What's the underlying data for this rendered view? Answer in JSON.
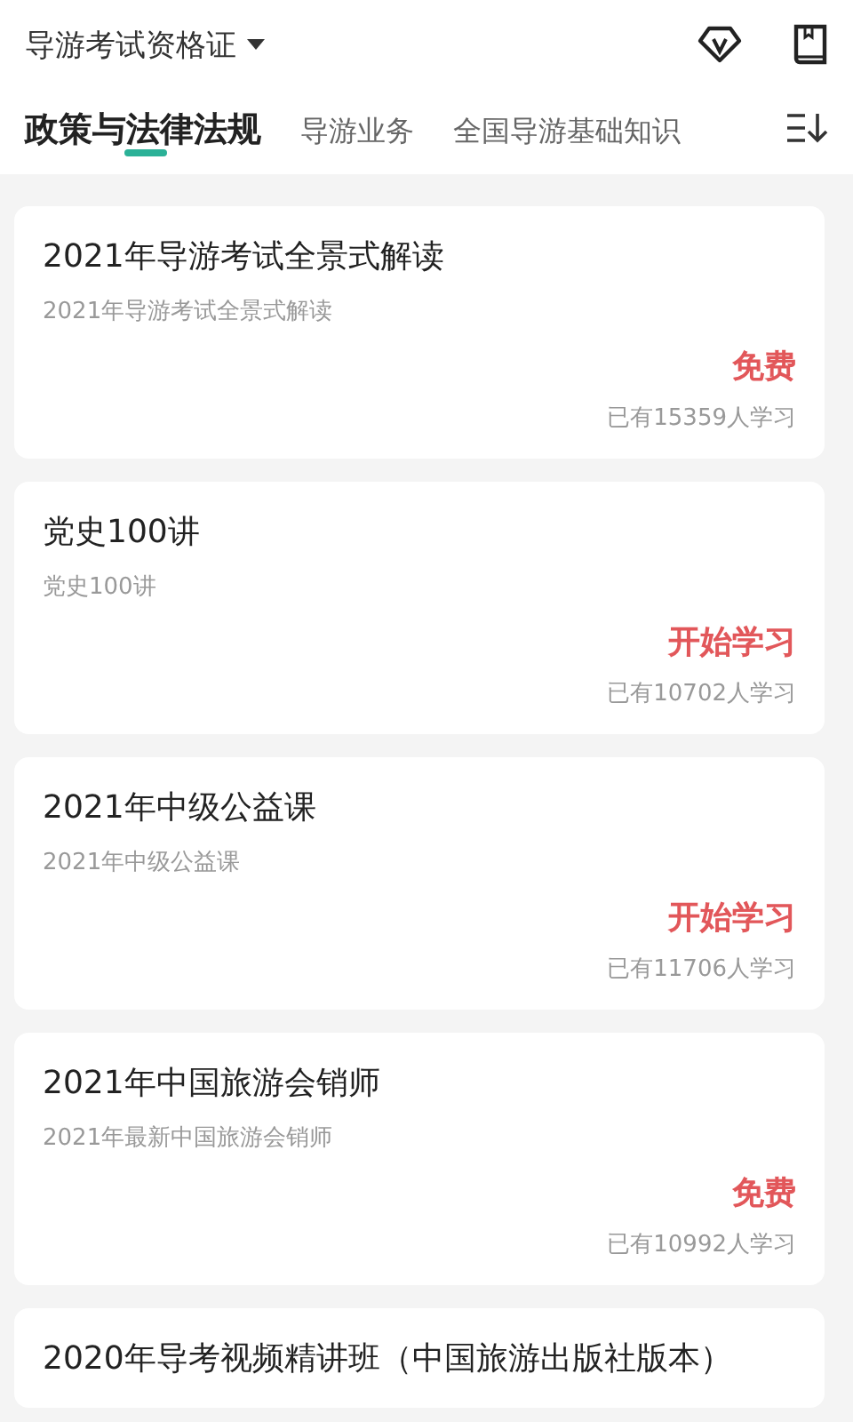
{
  "header": {
    "title": "导游考试资格证"
  },
  "tabs": [
    {
      "label": "政策与法律法规",
      "selected": true
    },
    {
      "label": "导游业务",
      "selected": false
    },
    {
      "label": "全国导游基础知识",
      "selected": false
    }
  ],
  "courses": [
    {
      "title": "2021年导游考试全景式解读",
      "subtitle": "2021年导游考试全景式解读",
      "action": "免费",
      "learners": "已有15359人学习"
    },
    {
      "title": "党史100讲",
      "subtitle": "党史100讲",
      "action": "开始学习",
      "learners": "已有10702人学习"
    },
    {
      "title": "2021年中级公益课",
      "subtitle": "2021年中级公益课",
      "action": "开始学习",
      "learners": "已有11706人学习"
    },
    {
      "title": "2021年中国旅游会销师",
      "subtitle": "2021年最新中国旅游会销师",
      "action": "免费",
      "learners": "已有10992人学习"
    },
    {
      "title": "2020年导考视频精讲班（中国旅游出版社版本）"
    }
  ]
}
